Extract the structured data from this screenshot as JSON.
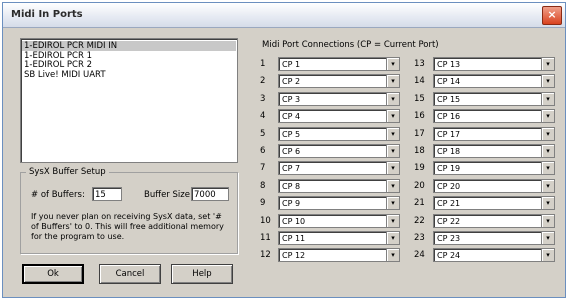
{
  "window": {
    "title": "Midi In Ports",
    "close_glyph": "×"
  },
  "input_ports": [
    "1-EDIROL PCR MIDI IN",
    "1-EDIROL PCR 1",
    "1-EDIROL PCR 2",
    "SB Live! MIDI UART"
  ],
  "selected_port_index": 0,
  "sysx": {
    "group_title": "SysX Buffer Setup",
    "num_buffers_label": "# of Buffers:",
    "num_buffers_value": "15",
    "buffer_size_label": "Buffer Size:",
    "buffer_size_value": "7000",
    "note": "If you never plan on receiving SysX data, set '# of Buffers' to 0. This will free additional memory for the program to use."
  },
  "buttons": {
    "ok": "Ok",
    "cancel": "Cancel",
    "help": "Help"
  },
  "connections": {
    "title": "Midi Port Connections (CP = Current Port)",
    "left": [
      {
        "num": "1",
        "value": "CP 1"
      },
      {
        "num": "2",
        "value": "CP 2"
      },
      {
        "num": "3",
        "value": "CP 3"
      },
      {
        "num": "4",
        "value": "CP 4"
      },
      {
        "num": "5",
        "value": "CP 5"
      },
      {
        "num": "6",
        "value": "CP 6"
      },
      {
        "num": "7",
        "value": "CP 7"
      },
      {
        "num": "8",
        "value": "CP 8"
      },
      {
        "num": "9",
        "value": "CP 9"
      },
      {
        "num": "10",
        "value": "CP 10"
      },
      {
        "num": "11",
        "value": "CP 11"
      },
      {
        "num": "12",
        "value": "CP 12"
      }
    ],
    "right": [
      {
        "num": "13",
        "value": "CP 13"
      },
      {
        "num": "14",
        "value": "CP 14"
      },
      {
        "num": "15",
        "value": "CP 15"
      },
      {
        "num": "16",
        "value": "CP 16"
      },
      {
        "num": "17",
        "value": "CP 17"
      },
      {
        "num": "18",
        "value": "CP 18"
      },
      {
        "num": "19",
        "value": "CP 19"
      },
      {
        "num": "20",
        "value": "CP 20"
      },
      {
        "num": "21",
        "value": "CP 21"
      },
      {
        "num": "22",
        "value": "CP 22"
      },
      {
        "num": "23",
        "value": "CP 23"
      },
      {
        "num": "24",
        "value": "CP 24"
      }
    ],
    "dropdown_glyph": "▾"
  }
}
